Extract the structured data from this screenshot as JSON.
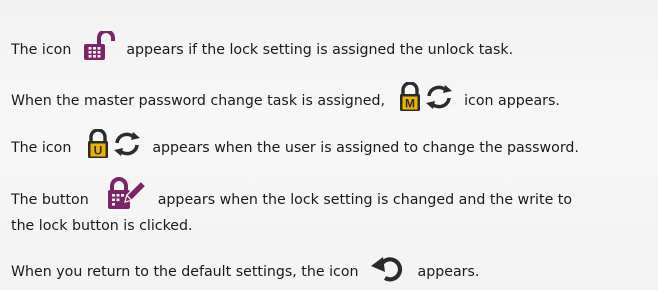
{
  "colors": {
    "purple": "#7b2567",
    "gold": "#f0b400",
    "dark": "#2b2b2b",
    "text": "#1a1a1a",
    "background": "#f4f4f4"
  },
  "items": [
    {
      "before": "The icon",
      "icon": "unlock-grid-icon",
      "after": "appears if the lock setting is assigned the unlock task."
    },
    {
      "before": "When the master password change task is assigned,",
      "icon": "master-lock-refresh-icon",
      "after": "icon appears."
    },
    {
      "before": "The icon",
      "icon": "user-lock-refresh-icon",
      "after": "appears when the user is assigned to change the password."
    },
    {
      "before": "The button",
      "icon": "lock-edit-icon",
      "after": "appears when the lock setting is changed and the write to",
      "after2": "the lock button is clicked."
    },
    {
      "before": "When you return to the default settings, the icon",
      "icon": "reset-arrow-icon",
      "after": "appears."
    }
  ],
  "icon_letters": {
    "master": "M",
    "user": "U"
  }
}
